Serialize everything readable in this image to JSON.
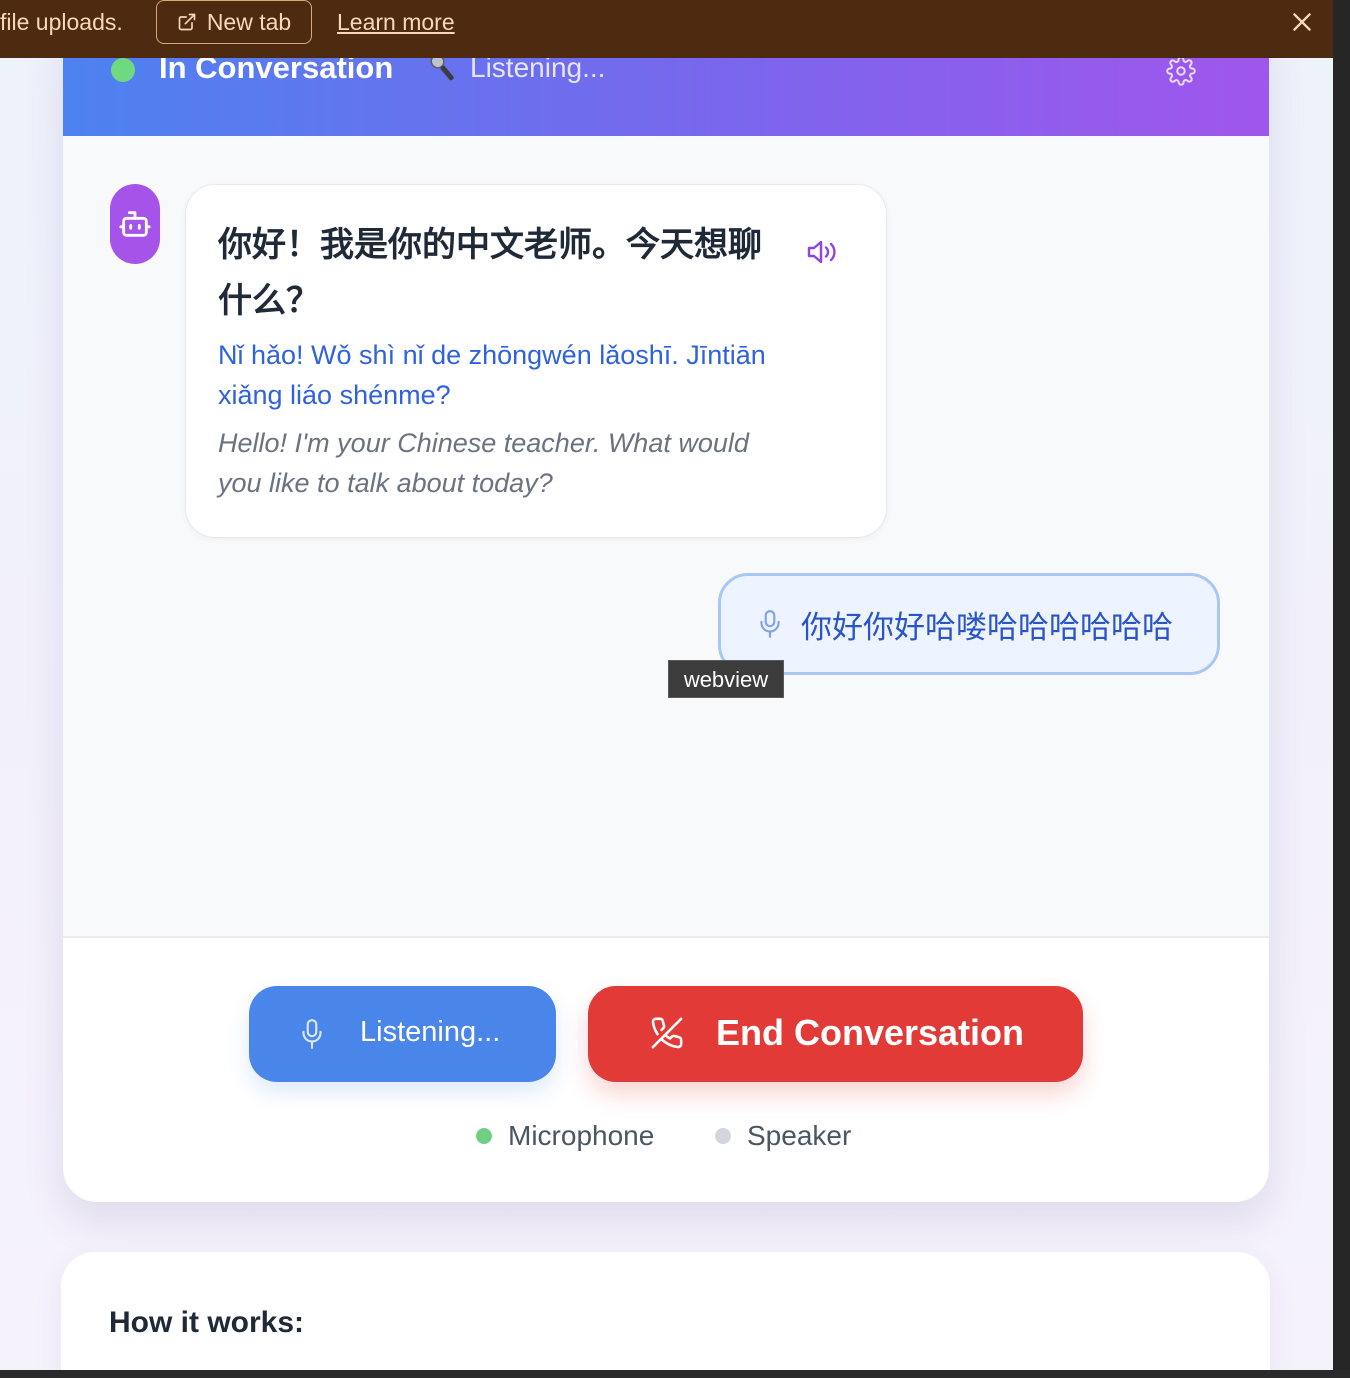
{
  "notice": {
    "message": "file uploads.",
    "new_tab_label": "New tab",
    "learn_more_label": "Learn more"
  },
  "header": {
    "title": "In Conversation",
    "status_emoji": "microphone",
    "status": "Listening..."
  },
  "chat": {
    "bot_message": {
      "chinese": "你好！我是你的中文老师。今天想聊什么？",
      "pinyin": "Nǐ hǎo! Wǒ shì nǐ de zhōngwén lǎoshī. Jīntiān xiǎng liáo shénme?",
      "english": "Hello! I'm your Chinese teacher. What would you like to talk about today?"
    },
    "user_message": "你好你好哈喽哈哈哈哈哈哈"
  },
  "tooltip": "webview",
  "controls": {
    "listen_label": "Listening...",
    "end_label": "End Conversation"
  },
  "indicators": {
    "microphone": "Microphone",
    "speaker": "Speaker",
    "microphone_color": "#6fcf82",
    "speaker_color": "#d2d5db"
  },
  "how_it_works": {
    "title": "How it works:"
  },
  "colors": {
    "notice_bg": "#4e2a10",
    "header_start": "#4d82f0",
    "header_end": "#a056ec",
    "avatar": "#a553e8",
    "listen_button": "#4a86ea",
    "end_button": "#e23a36",
    "pinyin": "#2f62dd"
  }
}
